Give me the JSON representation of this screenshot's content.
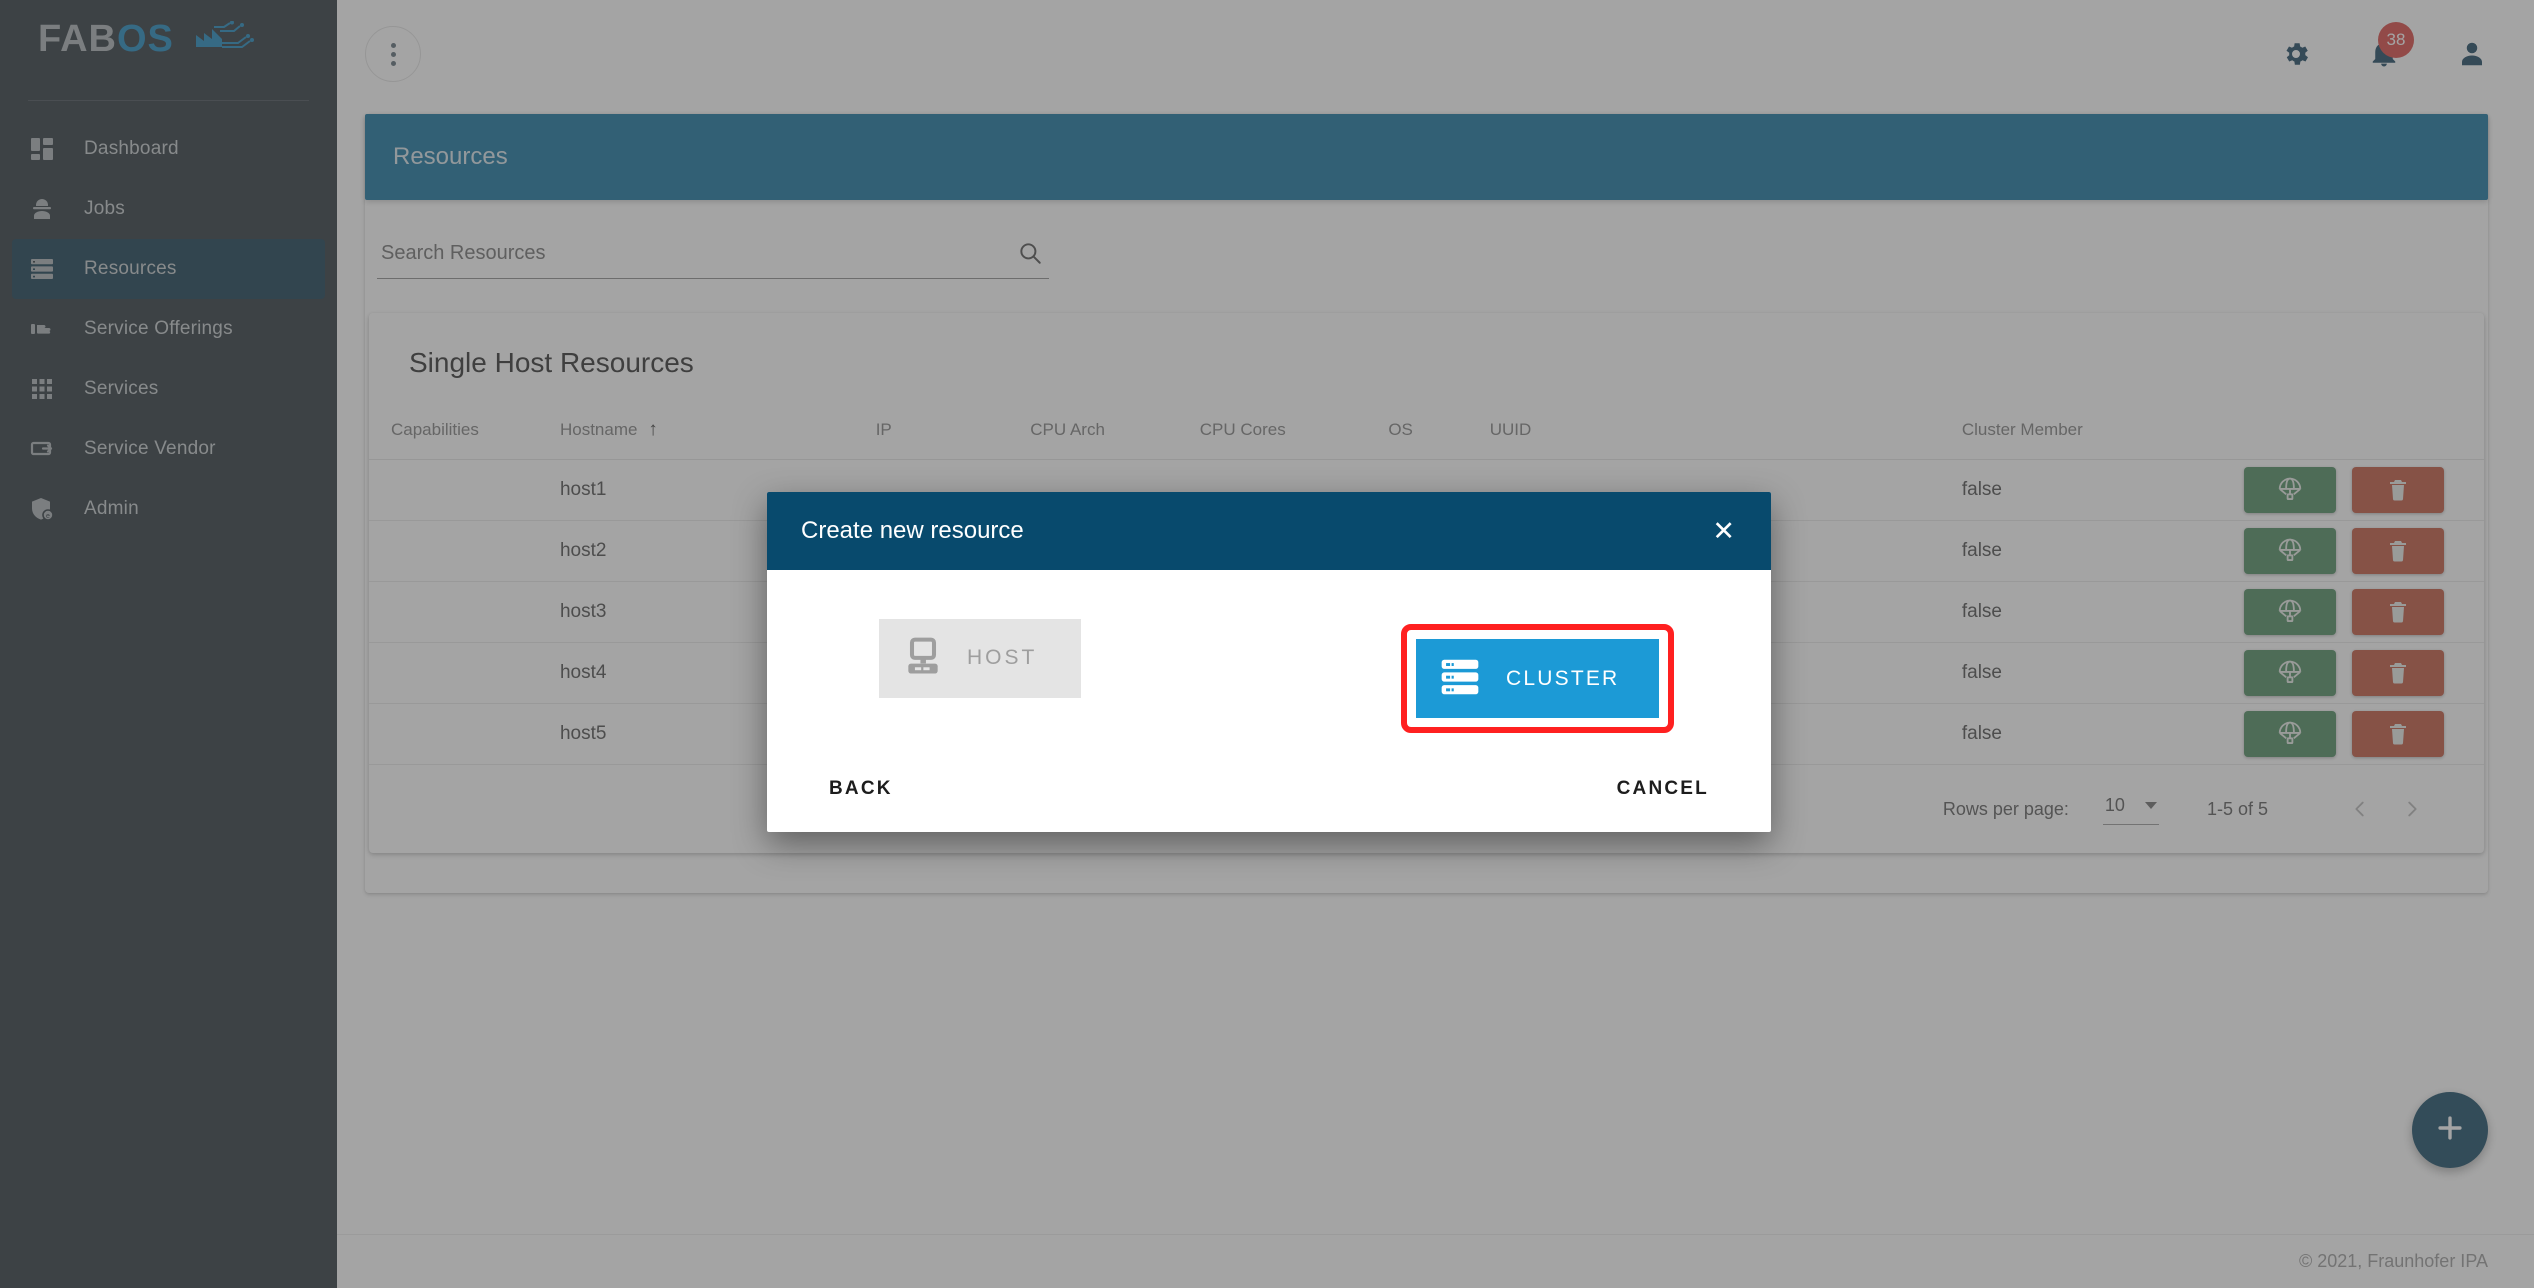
{
  "sidebar": {
    "logo": {
      "part1": "FAB",
      "part2": "OS",
      "mark_icon": "factory-circuit-logo"
    },
    "items": [
      {
        "label": "Dashboard",
        "icon": "dashboard-icon",
        "active": false
      },
      {
        "label": "Jobs",
        "icon": "worker-helmet-icon",
        "active": false
      },
      {
        "label": "Resources",
        "icon": "server-stack-icon",
        "active": true
      },
      {
        "label": "Service Offerings",
        "icon": "hand-offer-icon",
        "active": false
      },
      {
        "label": "Services",
        "icon": "grid-apps-icon",
        "active": false
      },
      {
        "label": "Service Vendor",
        "icon": "vendor-card-icon",
        "active": false
      },
      {
        "label": "Admin",
        "icon": "shield-admin-icon",
        "active": false
      }
    ]
  },
  "topbar": {
    "menu_icon": "kebab-menu-icon",
    "settings_icon": "gear-icon",
    "notifications_icon": "bell-icon",
    "notifications_count": "38",
    "account_icon": "person-icon"
  },
  "page": {
    "banner_title": "Resources"
  },
  "search": {
    "placeholder": "Search Resources",
    "value": "",
    "icon": "search-icon"
  },
  "table": {
    "title": "Single Host Resources",
    "sort_indicator": "↑",
    "sorted_column": "Hostname",
    "columns": [
      "Capabilities",
      "Hostname",
      "IP",
      "CPU Arch",
      "CPU Cores",
      "OS",
      "UUID",
      "Cluster Member"
    ],
    "rows": [
      {
        "capabilities": "",
        "hostname": "host1",
        "ip": "",
        "cpu_arch": "",
        "cpu_cores": "",
        "os": "",
        "uuid": "",
        "cluster_member": "false"
      },
      {
        "capabilities": "",
        "hostname": "host2",
        "ip": "",
        "cpu_arch": "",
        "cpu_cores": "",
        "os": "",
        "uuid": "",
        "cluster_member": "false"
      },
      {
        "capabilities": "",
        "hostname": "host3",
        "ip": "",
        "cpu_arch": "",
        "cpu_cores": "",
        "os": "",
        "uuid": "",
        "cluster_member": "false"
      },
      {
        "capabilities": "",
        "hostname": "host4",
        "ip": "",
        "cpu_arch": "",
        "cpu_cores": "",
        "os": "",
        "uuid": "",
        "cluster_member": "false"
      },
      {
        "capabilities": "",
        "hostname": "host5",
        "ip": "",
        "cpu_arch": "",
        "cpu_cores": "",
        "os": "",
        "uuid": "",
        "cluster_member": "false"
      }
    ],
    "row_actions": {
      "deploy_icon": "parachute-deploy-icon",
      "delete_icon": "trash-icon"
    }
  },
  "paginator": {
    "rows_per_page_label": "Rows per page:",
    "rows_per_page_value": "10",
    "range_label": "1-5 of 5",
    "prev_icon": "chevron-left-icon",
    "next_icon": "chevron-right-icon"
  },
  "fab": {
    "icon": "plus-icon"
  },
  "footer": {
    "copyright": "© 2021, Fraunhofer IPA"
  },
  "dialog": {
    "title": "Create new resource",
    "close_icon": "close-icon",
    "options": [
      {
        "label": "HOST",
        "icon": "computer-icon",
        "state": "disabled",
        "highlighted": false
      },
      {
        "label": "CLUSTER",
        "icon": "server-stack-icon",
        "state": "enabled",
        "highlighted": true
      }
    ],
    "back_label": "BACK",
    "cancel_label": "CANCEL",
    "highlight_color": "#ff2020",
    "header_color": "#084a6d",
    "cluster_color": "#1c9ad6"
  }
}
